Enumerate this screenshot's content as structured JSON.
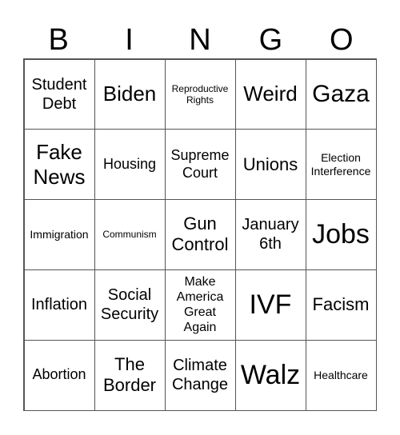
{
  "header": [
    "B",
    "I",
    "N",
    "G",
    "O"
  ],
  "cells": [
    "Student Debt",
    "Biden",
    "Reproductive Rights",
    "Weird",
    "Gaza",
    "Fake News",
    "Housing",
    "Supreme Court",
    "Unions",
    "Election Interference",
    "Immigration",
    "Communism",
    "Gun Control",
    "January 6th",
    "Jobs",
    "Inflation",
    "Social Security",
    "Make America Great Again",
    "IVF",
    "Facism",
    "Abortion",
    "The Border",
    "Climate Change",
    "Walz",
    "Healthcare"
  ]
}
